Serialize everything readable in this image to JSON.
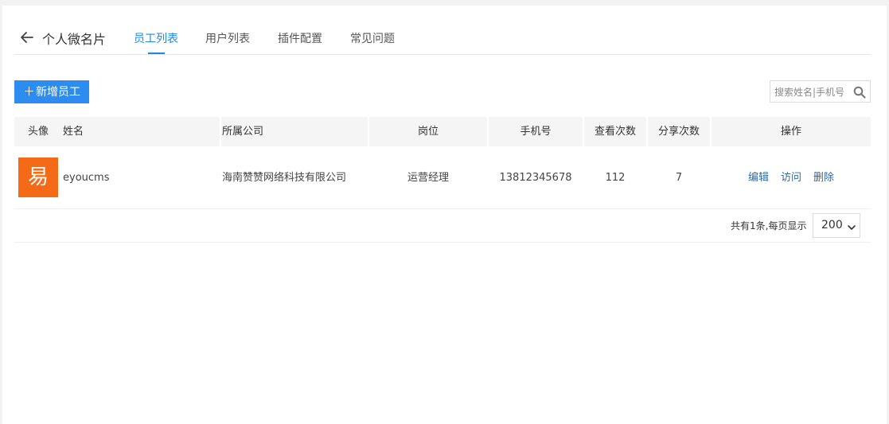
{
  "header": {
    "title": "个人微名片",
    "tabs": [
      {
        "label": "员工列表",
        "active": true
      },
      {
        "label": "用户列表",
        "active": false
      },
      {
        "label": "插件配置",
        "active": false
      },
      {
        "label": "常见问题",
        "active": false
      }
    ]
  },
  "toolbar": {
    "add_label": "新增员工",
    "search_placeholder": "搜索姓名|手机号"
  },
  "table": {
    "columns": [
      "头像",
      "姓名",
      "所属公司",
      "岗位",
      "手机号",
      "查看次数",
      "分享次数",
      "操作"
    ],
    "rows": [
      {
        "avatar_char": "易",
        "name": "eyoucms",
        "company": "海南赞赞网络科技有限公司",
        "position": "运营经理",
        "phone": "13812345678",
        "views": "112",
        "shares": "7",
        "actions": [
          "编辑",
          "访问",
          "删除"
        ]
      }
    ]
  },
  "pagination": {
    "info": "共有1条,每页显示",
    "page_size": "200"
  },
  "colors": {
    "accent": "#1e88e5",
    "button": "#2d8cf0",
    "avatar_bg": "#f56a17",
    "link": "#2d6aa8"
  }
}
